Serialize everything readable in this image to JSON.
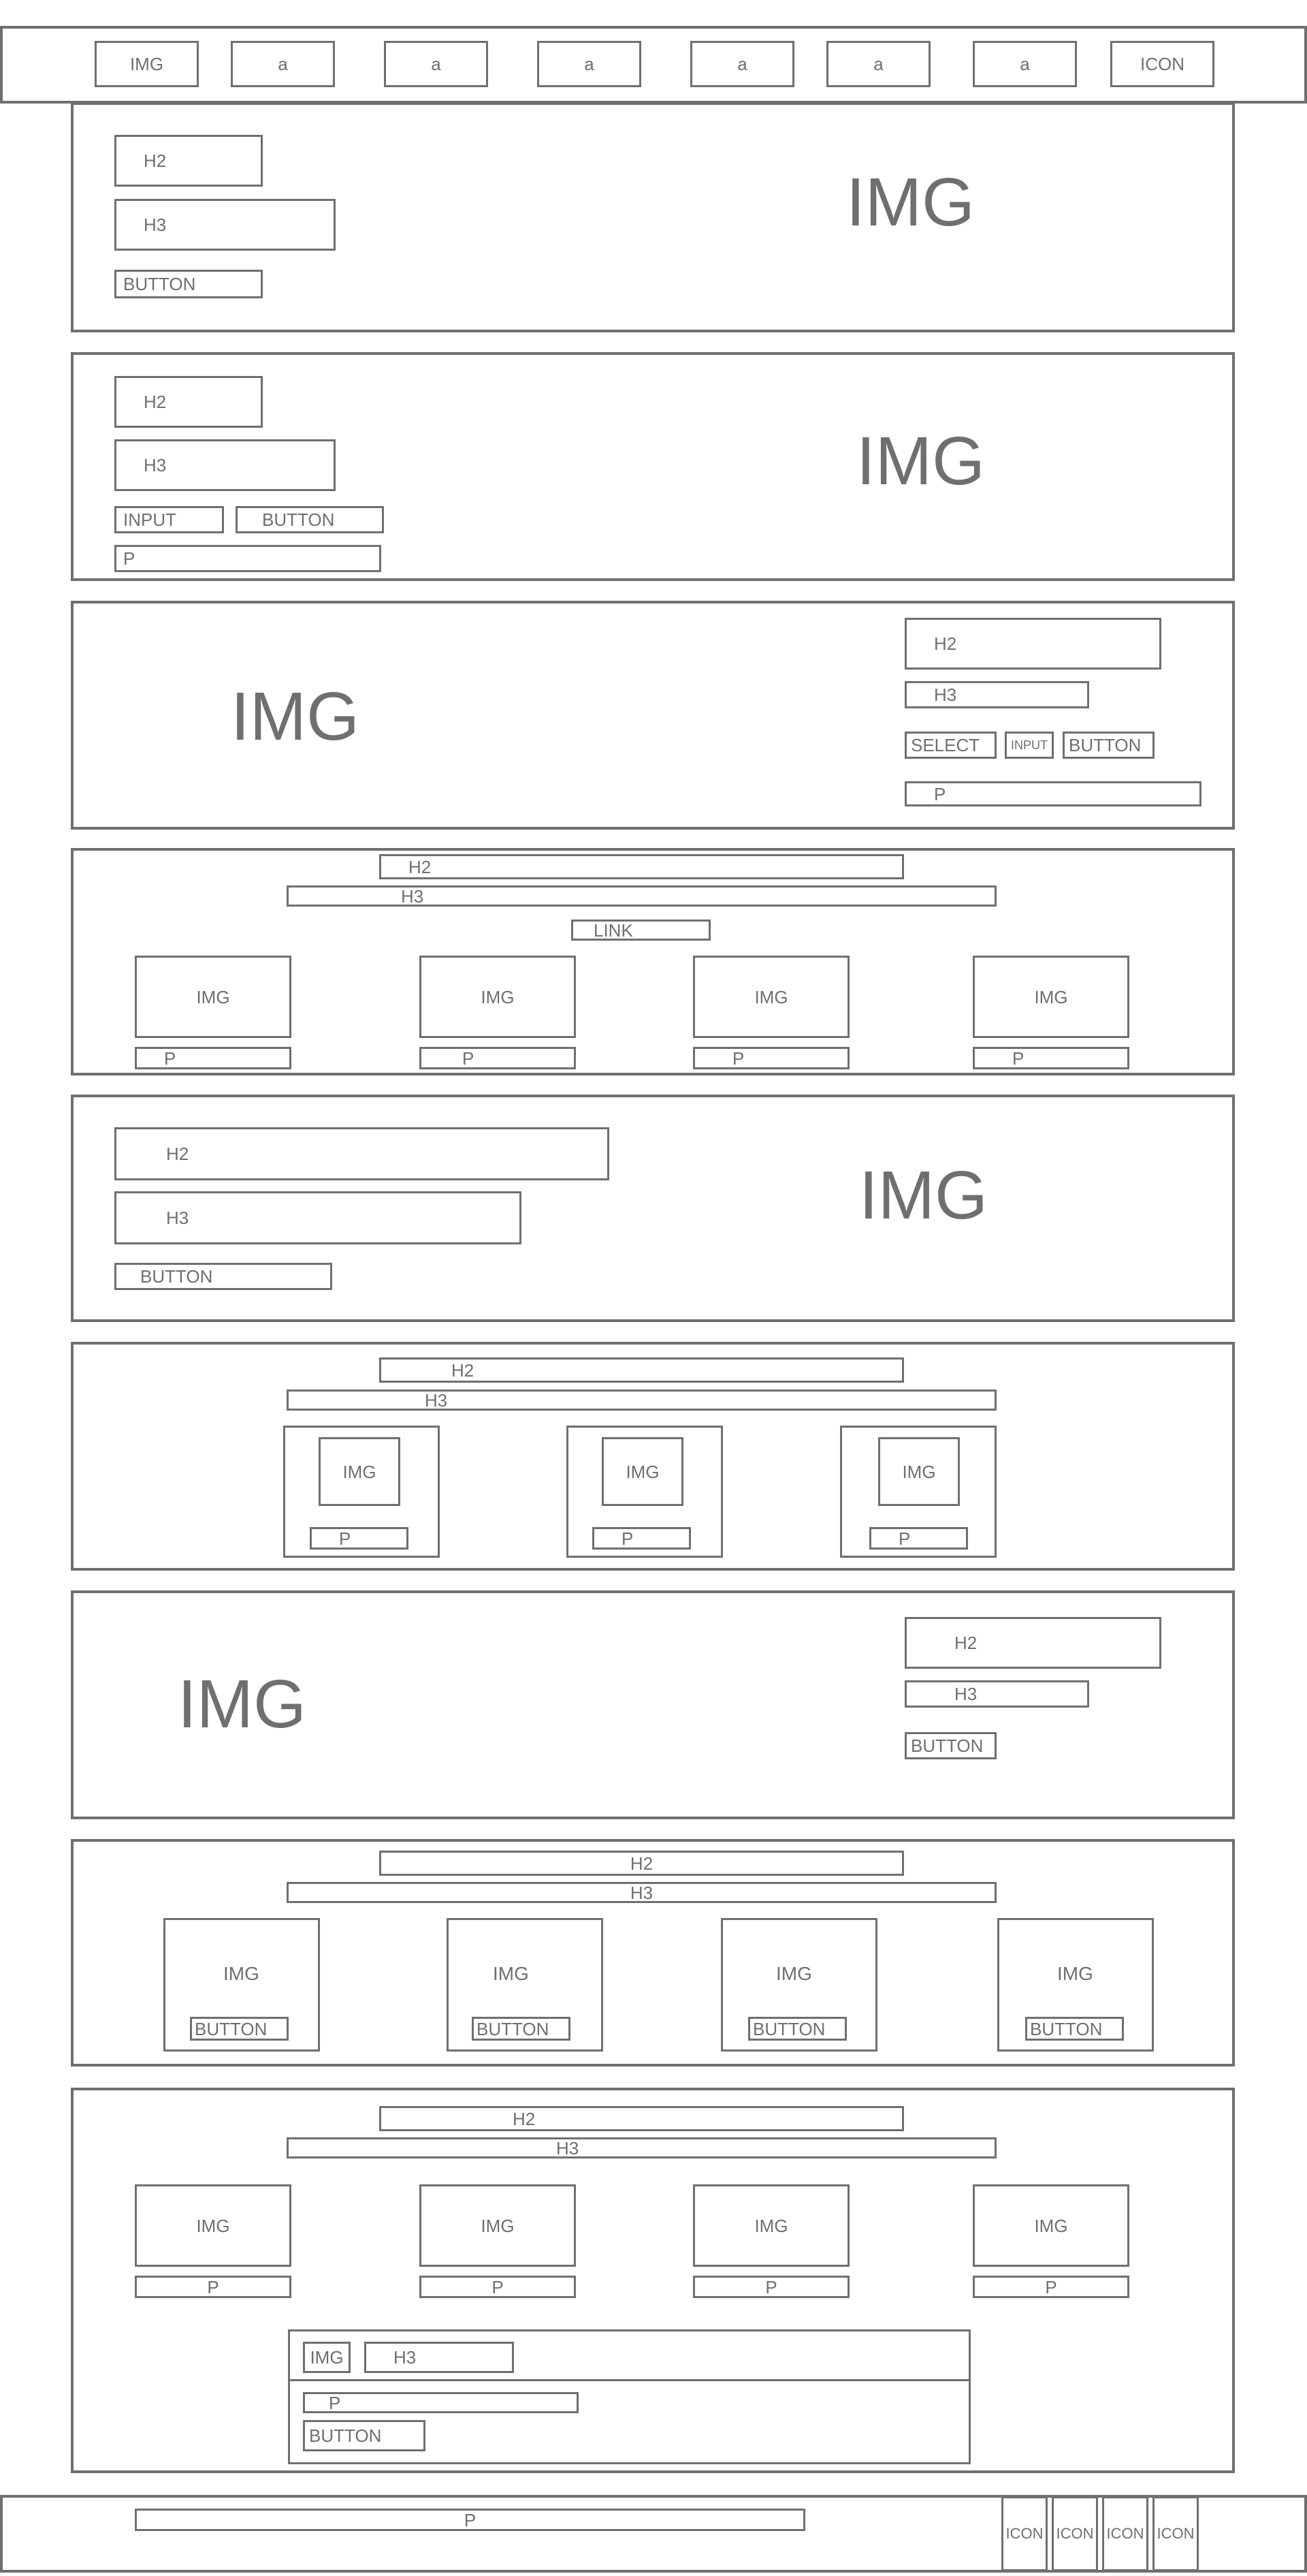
{
  "nav": {
    "logo": "IMG",
    "links": [
      "a",
      "a",
      "a",
      "a",
      "a",
      "a"
    ],
    "icon": "ICON"
  },
  "hero1": {
    "h2": "H2",
    "h3": "H3",
    "button": "BUTTON",
    "img": "IMG"
  },
  "hero2": {
    "h2": "H2",
    "h3": "H3",
    "input": "INPUT",
    "button": "BUTTON",
    "p": "P",
    "img": "IMG"
  },
  "section3": {
    "img": "IMG",
    "h2": "H2",
    "h3": "H3",
    "select": "SELECT",
    "input": "INPUT",
    "button": "BUTTON",
    "p": "P"
  },
  "section4": {
    "h2": "H2",
    "h3": "H3",
    "link": "LINK",
    "cards": [
      {
        "img": "IMG",
        "p": "P"
      },
      {
        "img": "IMG",
        "p": "P"
      },
      {
        "img": "IMG",
        "p": "P"
      },
      {
        "img": "IMG",
        "p": "P"
      }
    ]
  },
  "section5": {
    "h2": "H2",
    "h3": "H3",
    "button": "BUTTON",
    "img": "IMG"
  },
  "section6": {
    "h2": "H2",
    "h3": "H3",
    "cards": [
      {
        "img": "IMG",
        "p": "P"
      },
      {
        "img": "IMG",
        "p": "P"
      },
      {
        "img": "IMG",
        "p": "P"
      }
    ]
  },
  "section7": {
    "img": "IMG",
    "h2": "H2",
    "h3": "H3",
    "button": "BUTTON"
  },
  "section8": {
    "h2": "H2",
    "h3": "H3",
    "cards": [
      {
        "img": "IMG",
        "button": "BUTTON"
      },
      {
        "img": "IMG",
        "button": "BUTTON"
      },
      {
        "img": "IMG",
        "button": "BUTTON"
      },
      {
        "img": "IMG",
        "button": "BUTTON"
      }
    ]
  },
  "section9": {
    "h2": "H2",
    "h3": "H3",
    "cards": [
      {
        "img": "IMG",
        "p": "P"
      },
      {
        "img": "IMG",
        "p": "P"
      },
      {
        "img": "IMG",
        "p": "P"
      },
      {
        "img": "IMG",
        "p": "P"
      }
    ],
    "panel": {
      "img": "IMG",
      "h3": "H3",
      "p": "P",
      "button": "BUTTON"
    }
  },
  "footer": {
    "p": "P",
    "icons": [
      "ICON",
      "ICON",
      "ICON",
      "ICON"
    ]
  }
}
